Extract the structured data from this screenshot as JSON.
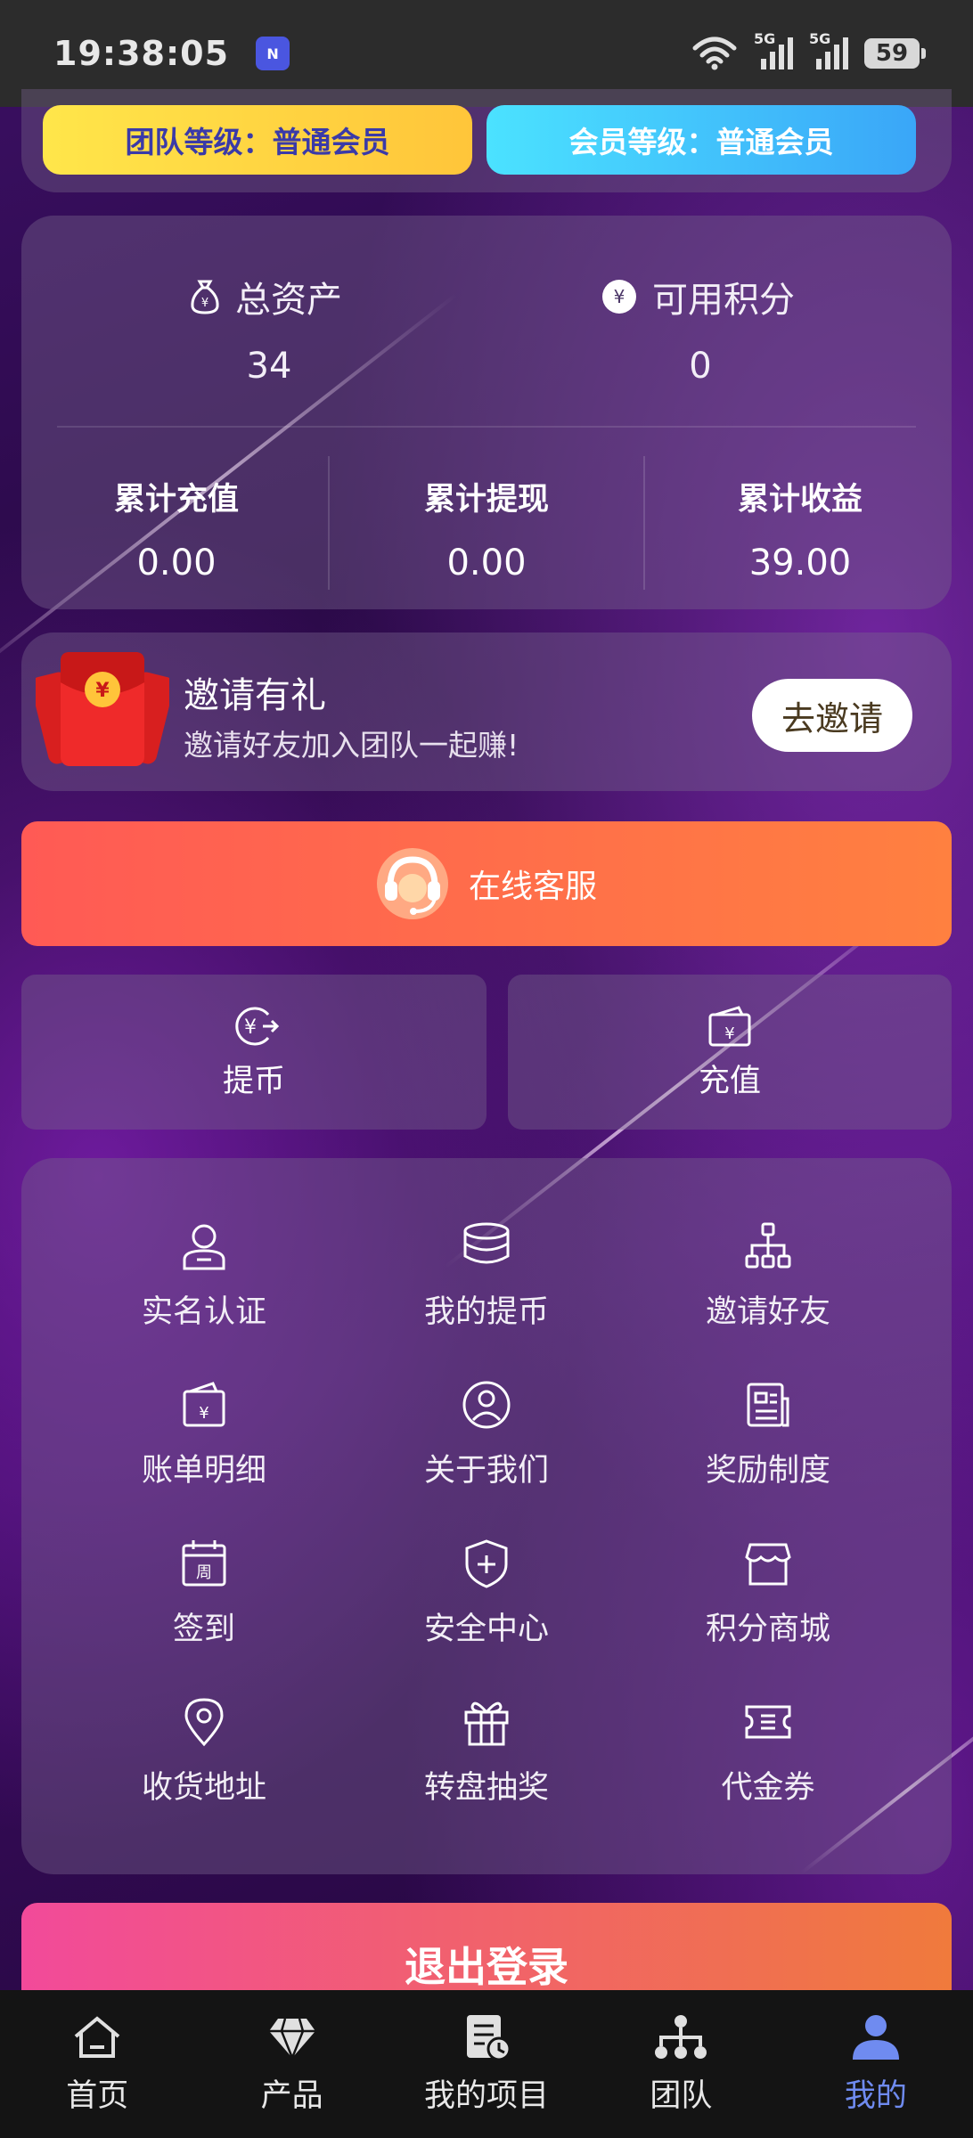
{
  "status_bar": {
    "time": "19:38:05",
    "app_badge": "N",
    "net1": "5G",
    "net2": "5G",
    "battery": "59"
  },
  "levels": {
    "team": "团队等级：普通会员",
    "member": "会员等级：普通会员"
  },
  "assets": {
    "total_label": "总资产",
    "total_value": "34",
    "points_label": "可用积分",
    "points_value": "0",
    "stats": [
      {
        "label": "累计充值",
        "value": "0.00"
      },
      {
        "label": "累计提现",
        "value": "0.00"
      },
      {
        "label": "累计收益",
        "value": "39.00"
      }
    ]
  },
  "invite": {
    "title": "邀请有礼",
    "subtitle": "邀请好友加入团队一起赚!",
    "button": "去邀请"
  },
  "service": {
    "label": "在线客服"
  },
  "actions": {
    "withdraw": "提币",
    "recharge": "充值"
  },
  "menu": [
    {
      "label": "实名认证",
      "icon": "user-icon"
    },
    {
      "label": "我的提币",
      "icon": "coins-icon"
    },
    {
      "label": "邀请好友",
      "icon": "network-icon"
    },
    {
      "label": "账单明细",
      "icon": "wallet-icon"
    },
    {
      "label": "关于我们",
      "icon": "person-circle-icon"
    },
    {
      "label": "奖励制度",
      "icon": "document-icon"
    },
    {
      "label": "签到",
      "icon": "calendar-icon"
    },
    {
      "label": "安全中心",
      "icon": "shield-icon"
    },
    {
      "label": "积分商城",
      "icon": "store-icon"
    },
    {
      "label": "收货地址",
      "icon": "location-icon"
    },
    {
      "label": "转盘抽奖",
      "icon": "gift-icon"
    },
    {
      "label": "代金券",
      "icon": "ticket-icon"
    }
  ],
  "calendar_glyph": "周",
  "logout": "退出登录",
  "tabs": [
    {
      "label": "首页",
      "icon": "home-icon"
    },
    {
      "label": "产品",
      "icon": "diamond-icon"
    },
    {
      "label": "我的项目",
      "icon": "project-icon"
    },
    {
      "label": "团队",
      "icon": "team-icon"
    },
    {
      "label": "我的",
      "icon": "profile-icon",
      "active": true
    }
  ],
  "colors": {
    "accent": "#6f8bf0",
    "service": "#ff6a4a",
    "team_pill": "#ffd93f",
    "member_pill": "#42c4fb"
  }
}
